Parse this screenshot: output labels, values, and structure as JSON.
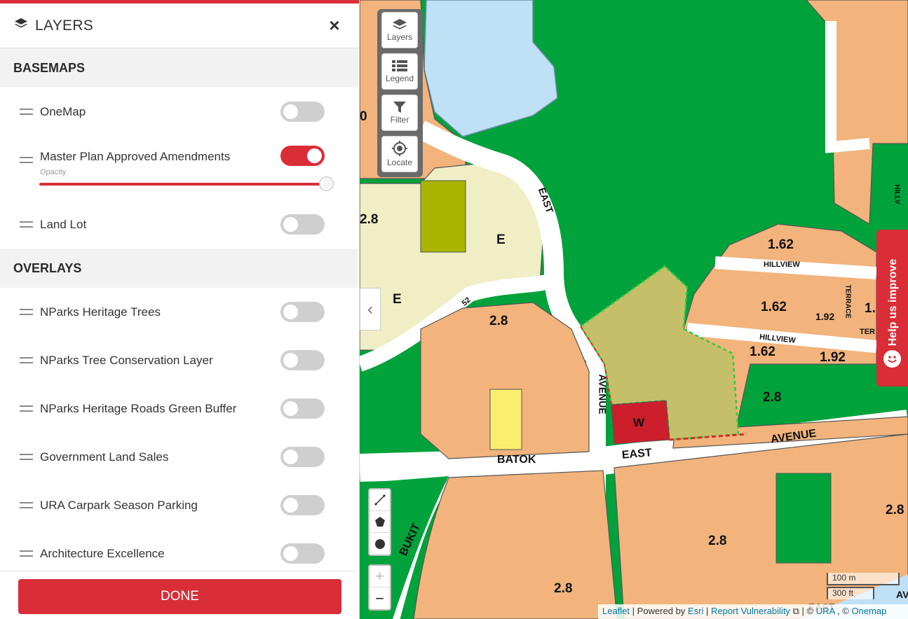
{
  "panel": {
    "title": "LAYERS",
    "close_icon": "×",
    "basemaps_header": "BASEMAPS",
    "overlays_header": "OVERLAYS",
    "opacity_label": "Opacity",
    "opacity_value": 1.0,
    "basemaps": [
      {
        "label": "OneMap",
        "on": false
      },
      {
        "label": "Master Plan Approved Amendments",
        "on": true
      },
      {
        "label": "Land Lot",
        "on": false
      }
    ],
    "overlays": [
      {
        "label": "NParks Heritage Trees",
        "on": false
      },
      {
        "label": "NParks Tree Conservation Layer",
        "on": false
      },
      {
        "label": "NParks Heritage Roads Green Buffer",
        "on": false
      },
      {
        "label": "Government Land Sales",
        "on": false
      },
      {
        "label": "URA Carpark Season Parking",
        "on": false
      },
      {
        "label": "Architecture Excellence",
        "on": false
      }
    ],
    "done_label": "DONE"
  },
  "map_controls": {
    "layers": "Layers",
    "legend": "Legend",
    "filter": "Filter",
    "locate": "Locate",
    "collapse_icon": "‹",
    "zoom_in": "+",
    "zoom_out": "−"
  },
  "help_label": "Help us improve",
  "scale": {
    "metric": "100 m",
    "imperial": "300 ft"
  },
  "attribution": {
    "leaflet": "Leaflet",
    "powered": "| Powered by",
    "esri": "Esri",
    "sep": "|",
    "report": "Report Vulnerability",
    "copy1": "| ©",
    "ura": "URA",
    "copy2": ", ©",
    "onemap": "Onemap"
  },
  "map_labels": {
    "e1": "E",
    "e2": "E",
    "w": "W",
    "v28a": "2.8",
    "v28b": "2.8",
    "v28c": "2.8",
    "v28d": "2.8",
    "v28e": "2.8",
    "v28f": "2.8",
    "v162a": "1.62",
    "v162b": "1.62",
    "v162c": "1.62",
    "v192a": "1.92",
    "v192b": "1.92",
    "v1": "1.",
    "v0": "0",
    "r52": "52",
    "east1": "EAST",
    "east2": "EAST",
    "avenue1": "AVENUE",
    "avenue2": "AVENUE",
    "batok": "BATOK",
    "bukit": "BUKIT",
    "hillview1": "HILLVIEW",
    "hillview2": "HILLVIEW",
    "terrace": "TERRACE",
    "ter": "TER",
    "hillv": "HILLV",
    "east3": "EAST",
    "ave3": "AVE"
  },
  "colors": {
    "accent": "#d92d38",
    "park": "#00a23b",
    "residential": "#f2b47c",
    "water": "#bfe0f5"
  }
}
